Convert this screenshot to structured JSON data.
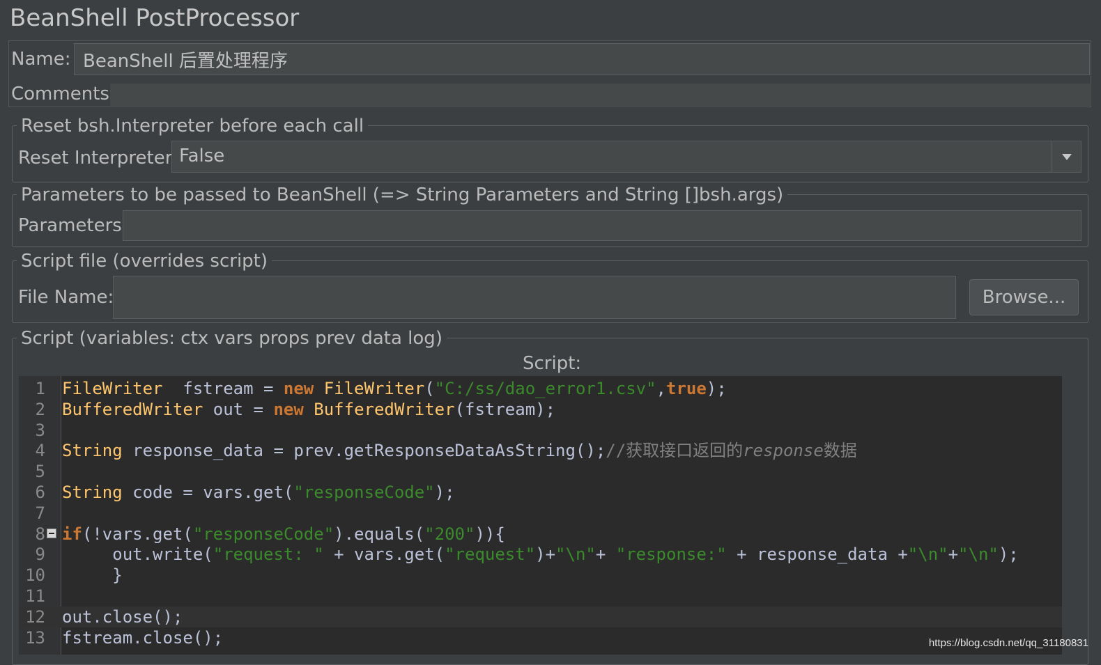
{
  "title": "BeanShell PostProcessor",
  "name_field": {
    "label": "Name:",
    "value": "BeanShell 后置处理程序"
  },
  "comments_field": {
    "label": "Comments:",
    "value": ""
  },
  "reset_group": {
    "legend": "Reset bsh.Interpreter before each call",
    "label": "Reset Interpreter:",
    "value": "False"
  },
  "params_group": {
    "legend": "Parameters to be passed to BeanShell (=> String Parameters and String []bsh.args)",
    "label": "Parameters:",
    "value": ""
  },
  "file_group": {
    "legend": "Script file (overrides script)",
    "label": "File Name:",
    "value": "",
    "browse_label": "Browse..."
  },
  "script_group": {
    "legend": "Script (variables: ctx vars props prev data log)",
    "script_label": "Script:"
  },
  "code_lines": [
    {
      "n": "1",
      "tokens": [
        [
          "ty",
          "FileWriter"
        ],
        [
          "p",
          "  fstream = "
        ],
        [
          "kw",
          "new"
        ],
        [
          "p",
          " "
        ],
        [
          "ty",
          "FileWriter"
        ],
        [
          "p",
          "("
        ],
        [
          "str",
          "\"C:/ss/dao_error1.csv\""
        ],
        [
          "p",
          ","
        ],
        [
          "kw",
          "true"
        ],
        [
          "p",
          ");"
        ]
      ]
    },
    {
      "n": "2",
      "tokens": [
        [
          "ty",
          "BufferedWriter"
        ],
        [
          "p",
          " out = "
        ],
        [
          "kw",
          "new"
        ],
        [
          "p",
          " "
        ],
        [
          "ty",
          "BufferedWriter"
        ],
        [
          "p",
          "(fstream);"
        ]
      ]
    },
    {
      "n": "3",
      "tokens": []
    },
    {
      "n": "4",
      "tokens": [
        [
          "ty",
          "String"
        ],
        [
          "p",
          " response_data = prev.getResponseDataAsString();"
        ],
        [
          "cm",
          "//获取接口返回的"
        ],
        [
          "cm-it",
          "response"
        ],
        [
          "cm",
          "数据"
        ]
      ]
    },
    {
      "n": "5",
      "tokens": []
    },
    {
      "n": "6",
      "tokens": [
        [
          "ty",
          "String"
        ],
        [
          "p",
          " code = vars.get("
        ],
        [
          "str",
          "\"responseCode\""
        ],
        [
          "p",
          ");"
        ]
      ]
    },
    {
      "n": "7",
      "tokens": []
    },
    {
      "n": "8",
      "fold": true,
      "tokens": [
        [
          "kw",
          "if"
        ],
        [
          "p",
          "(!vars.get("
        ],
        [
          "str",
          "\"responseCode\""
        ],
        [
          "p",
          ").equals("
        ],
        [
          "str",
          "\"200\""
        ],
        [
          "p",
          ")){"
        ]
      ]
    },
    {
      "n": "9",
      "tokens": [
        [
          "p",
          "     out.write("
        ],
        [
          "str",
          "\"request: \""
        ],
        [
          "p",
          " + vars.get("
        ],
        [
          "str",
          "\"request\""
        ],
        [
          "p",
          ")+"
        ],
        [
          "str",
          "\"\\n\""
        ],
        [
          "p",
          "+ "
        ],
        [
          "str",
          "\"response:\""
        ],
        [
          "p",
          " + response_data +"
        ],
        [
          "str",
          "\"\\n\""
        ],
        [
          "p",
          "+"
        ],
        [
          "str",
          "\"\\n\""
        ],
        [
          "p",
          ");"
        ]
      ]
    },
    {
      "n": "10",
      "tokens": [
        [
          "p",
          "     }"
        ]
      ]
    },
    {
      "n": "11",
      "tokens": []
    },
    {
      "n": "12",
      "current": true,
      "tokens": [
        [
          "p",
          "out.close();"
        ]
      ]
    },
    {
      "n": "13",
      "tokens": [
        [
          "p",
          "fstream.close();"
        ]
      ]
    }
  ],
  "watermark": "https://blog.csdn.net/qq_31180831",
  "icons": {
    "dropdown": "chevron-down-icon",
    "fold": "fold-collapse-icon"
  },
  "colors": {
    "background": "#3c3f41",
    "editor_bg": "#2b2b2b",
    "keyword": "#cc7832",
    "type": "#ffc66d",
    "string": "#3b8a2c",
    "comment": "#808080"
  }
}
